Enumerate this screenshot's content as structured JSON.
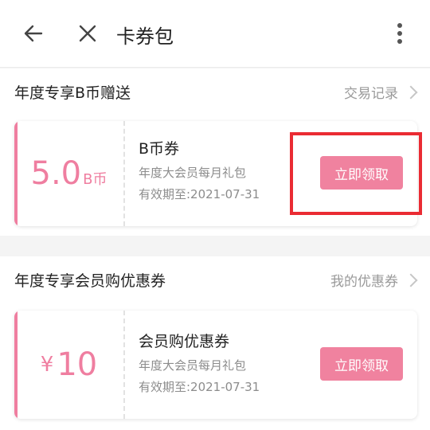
{
  "header": {
    "title": "卡券包",
    "icons": [
      "arrow-left-icon",
      "close-icon",
      "more-vertical-icon"
    ]
  },
  "sections": [
    {
      "title": "年度专享B币赠送",
      "link": "交易记录",
      "card": {
        "amount": "5.0",
        "unit": "B币",
        "name": "B币券",
        "desc": "年度大会员每月礼包",
        "date": "有效期至:2021-07-31",
        "button": "立即领取"
      }
    },
    {
      "title": "年度专享会员购优惠券",
      "link": "我的优惠券",
      "card": {
        "symbol": "¥",
        "amount": "10",
        "name": "会员购优惠券",
        "desc": "年度大会员每月礼包",
        "date": "有效期至:2021-07-31",
        "button": "立即领取"
      }
    }
  ],
  "colors": {
    "accent": "#ef7ea0",
    "button": "#f0829f",
    "highlight": "#ea2b33"
  }
}
